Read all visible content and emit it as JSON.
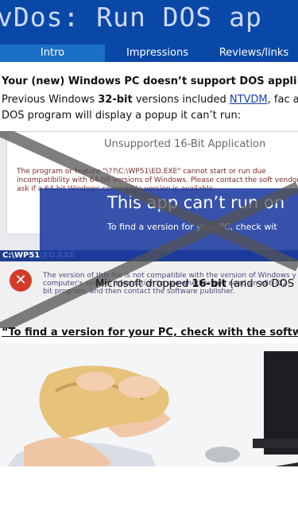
{
  "banner": {
    "title": "vDos: Run DOS ap"
  },
  "tabs": [
    {
      "label": "Intro"
    },
    {
      "label": "Impressions"
    },
    {
      "label": "Reviews/links"
    }
  ],
  "article": {
    "heading": "Your (new) Windows PC doesn’t support DOS appli",
    "para_part1": "Previous Windows ",
    "para_bold": "32-bit",
    "para_part2": " versions included ",
    "para_link": "NTVDM",
    "para_part3": ", fac a DOS program will display a popup it can’t run:",
    "caption_part1": "Microsoft dropped ",
    "caption_bold": "16-bit",
    "caption_part2": " (and so DOS",
    "quote": "“To find a version for your PC, check with the softw"
  },
  "screenshot": {
    "dialog1_title": "Unsupported 16-Bit Application",
    "dialog1_body": "The program or feature \"\\??\\C:\\WP51\\ED.EXE\" cannot start or run due incompatibility with 64-bit versions of Windows. Please contact the soft vendor to ask if a 64-bit Windows compatible version is available.",
    "overlay_title": "This app can’t run on",
    "overlay_sub": "To find a version for your PC, check wit",
    "dialog2_title": "C:\\WP51\\ED.EXE",
    "dialog2_body": "The version of this file is not compatible with the version of Windows y computer's system information to see whether you need an x86 (32-bit program, and then contact the software publisher."
  },
  "colors": {
    "banner": "#0a48a8",
    "active_tab": "#1b6fc7",
    "overlay": "#1c3aa0"
  }
}
